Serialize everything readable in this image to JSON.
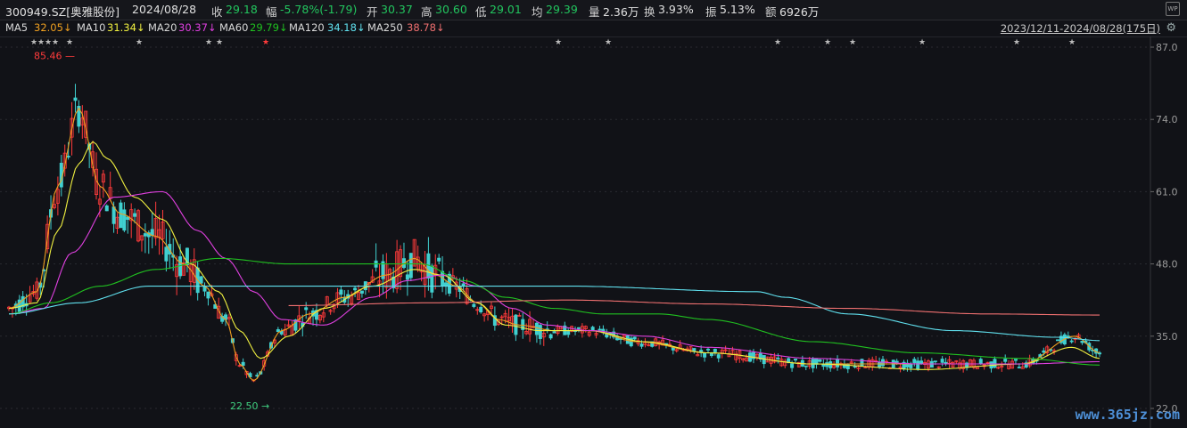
{
  "header": {
    "code": "300949.SZ[奥雅股份]",
    "date": "2024/08/28",
    "close_label": "收",
    "close": "29.18",
    "change_label": "幅",
    "change": "-5.78%(-1.79)",
    "open_label": "开",
    "open": "30.37",
    "high_label": "高",
    "high": "30.60",
    "low_label": "低",
    "low": "29.01",
    "avg_label": "均",
    "avg": "29.39",
    "vol_label": "量",
    "vol": "2.36万",
    "turnover_label": "换",
    "turnover": "3.93%",
    "amplitude_label": "振",
    "amplitude": "5.13%",
    "amount_label": "额",
    "amount": "6926万"
  },
  "wp_badge": "WP",
  "ma_legend": {
    "ma5_label": "MA5",
    "ma5": "32.05↓",
    "ma10_label": "MA10",
    "ma10": "31.34↓",
    "ma20_label": "MA20",
    "ma20": "30.37↓",
    "ma60_label": "MA60",
    "ma60": "29.79↓",
    "ma120_label": "MA120",
    "ma120": "34.18↓",
    "ma250_label": "MA250",
    "ma250": "38.78↓"
  },
  "date_range": "2023/12/11-2024/08/28(175日)",
  "watermark": "www.365jz.com",
  "colors": {
    "up": "#ff3b3b",
    "down": "#40d0d0",
    "ma5": "#f0a020",
    "ma10": "#f0f040",
    "ma20": "#e040e0",
    "ma60": "#20c020",
    "ma120": "#60e0ee",
    "ma250": "#f07070",
    "axis_text": "#9a9a9a",
    "grid": "#2a2b31"
  },
  "chart_data": {
    "type": "candlestick",
    "ylim": [
      22,
      87
    ],
    "y_ticks": [
      "87.0",
      "74.0",
      "61.0",
      "48.0",
      "35.0",
      "22.0"
    ],
    "max_label": "85.46",
    "min_label": "22.50",
    "star_markers_count": 17,
    "series_names": [
      "MA5",
      "MA10",
      "MA20",
      "MA60",
      "MA120",
      "MA250"
    ],
    "ma_waypoints": {
      "MA5": [
        [
          0,
          40
        ],
        [
          8,
          43
        ],
        [
          14,
          62
        ],
        [
          20,
          76
        ],
        [
          26,
          62
        ],
        [
          32,
          57
        ],
        [
          42,
          53
        ],
        [
          50,
          48
        ],
        [
          56,
          44
        ],
        [
          62,
          38
        ],
        [
          66,
          30
        ],
        [
          70,
          27
        ],
        [
          78,
          36
        ],
        [
          86,
          39
        ],
        [
          96,
          42
        ],
        [
          108,
          46
        ],
        [
          116,
          49
        ],
        [
          122,
          46
        ],
        [
          128,
          44
        ],
        [
          134,
          41
        ],
        [
          140,
          38
        ],
        [
          146,
          37
        ],
        [
          156,
          36
        ],
        [
          166,
          36
        ],
        [
          180,
          34
        ],
        [
          200,
          32
        ],
        [
          230,
          30
        ],
        [
          262,
          30
        ],
        [
          290,
          30
        ],
        [
          305,
          35
        ],
        [
          312,
          32
        ]
      ],
      "MA10": [
        [
          0,
          40
        ],
        [
          8,
          41
        ],
        [
          14,
          54
        ],
        [
          20,
          66
        ],
        [
          24,
          70
        ],
        [
          28,
          67
        ],
        [
          36,
          60
        ],
        [
          44,
          56
        ],
        [
          52,
          48
        ],
        [
          60,
          43
        ],
        [
          66,
          36
        ],
        [
          72,
          31
        ],
        [
          80,
          35
        ],
        [
          90,
          40
        ],
        [
          104,
          44
        ],
        [
          116,
          47
        ],
        [
          124,
          46
        ],
        [
          134,
          41
        ],
        [
          142,
          37
        ],
        [
          152,
          36
        ],
        [
          166,
          36
        ],
        [
          182,
          34
        ],
        [
          200,
          32
        ],
        [
          230,
          30
        ],
        [
          262,
          29
        ],
        [
          290,
          30
        ],
        [
          304,
          33
        ],
        [
          312,
          31
        ]
      ],
      "MA20": [
        [
          0,
          39
        ],
        [
          10,
          40
        ],
        [
          18,
          50
        ],
        [
          30,
          60
        ],
        [
          44,
          61
        ],
        [
          54,
          54
        ],
        [
          62,
          49
        ],
        [
          70,
          43
        ],
        [
          78,
          38
        ],
        [
          90,
          37
        ],
        [
          104,
          42
        ],
        [
          114,
          45
        ],
        [
          124,
          46
        ],
        [
          134,
          44
        ],
        [
          144,
          40
        ],
        [
          154,
          37
        ],
        [
          166,
          36
        ],
        [
          182,
          35
        ],
        [
          200,
          33
        ],
        [
          230,
          31
        ],
        [
          262,
          30
        ],
        [
          290,
          30
        ],
        [
          312,
          30.4
        ]
      ],
      "MA60": [
        [
          0,
          39
        ],
        [
          12,
          41
        ],
        [
          26,
          44
        ],
        [
          42,
          47
        ],
        [
          60,
          49
        ],
        [
          80,
          48
        ],
        [
          100,
          48
        ],
        [
          118,
          48
        ],
        [
          130,
          45
        ],
        [
          142,
          42
        ],
        [
          156,
          40
        ],
        [
          170,
          39
        ],
        [
          186,
          39
        ],
        [
          200,
          38
        ],
        [
          230,
          34
        ],
        [
          260,
          32
        ],
        [
          290,
          31
        ],
        [
          312,
          29.8
        ]
      ],
      "MA120": [
        [
          0,
          39
        ],
        [
          20,
          41
        ],
        [
          40,
          44
        ],
        [
          70,
          44
        ],
        [
          110,
          44
        ],
        [
          160,
          44
        ],
        [
          214,
          43
        ],
        [
          222,
          42
        ],
        [
          240,
          39
        ],
        [
          270,
          36
        ],
        [
          300,
          34.8
        ],
        [
          312,
          34.2
        ]
      ],
      "MA250": [
        [
          80,
          40.5
        ],
        [
          120,
          41
        ],
        [
          160,
          41.5
        ],
        [
          200,
          40.8
        ],
        [
          240,
          40
        ],
        [
          280,
          39
        ],
        [
          312,
          38.8
        ]
      ]
    }
  }
}
